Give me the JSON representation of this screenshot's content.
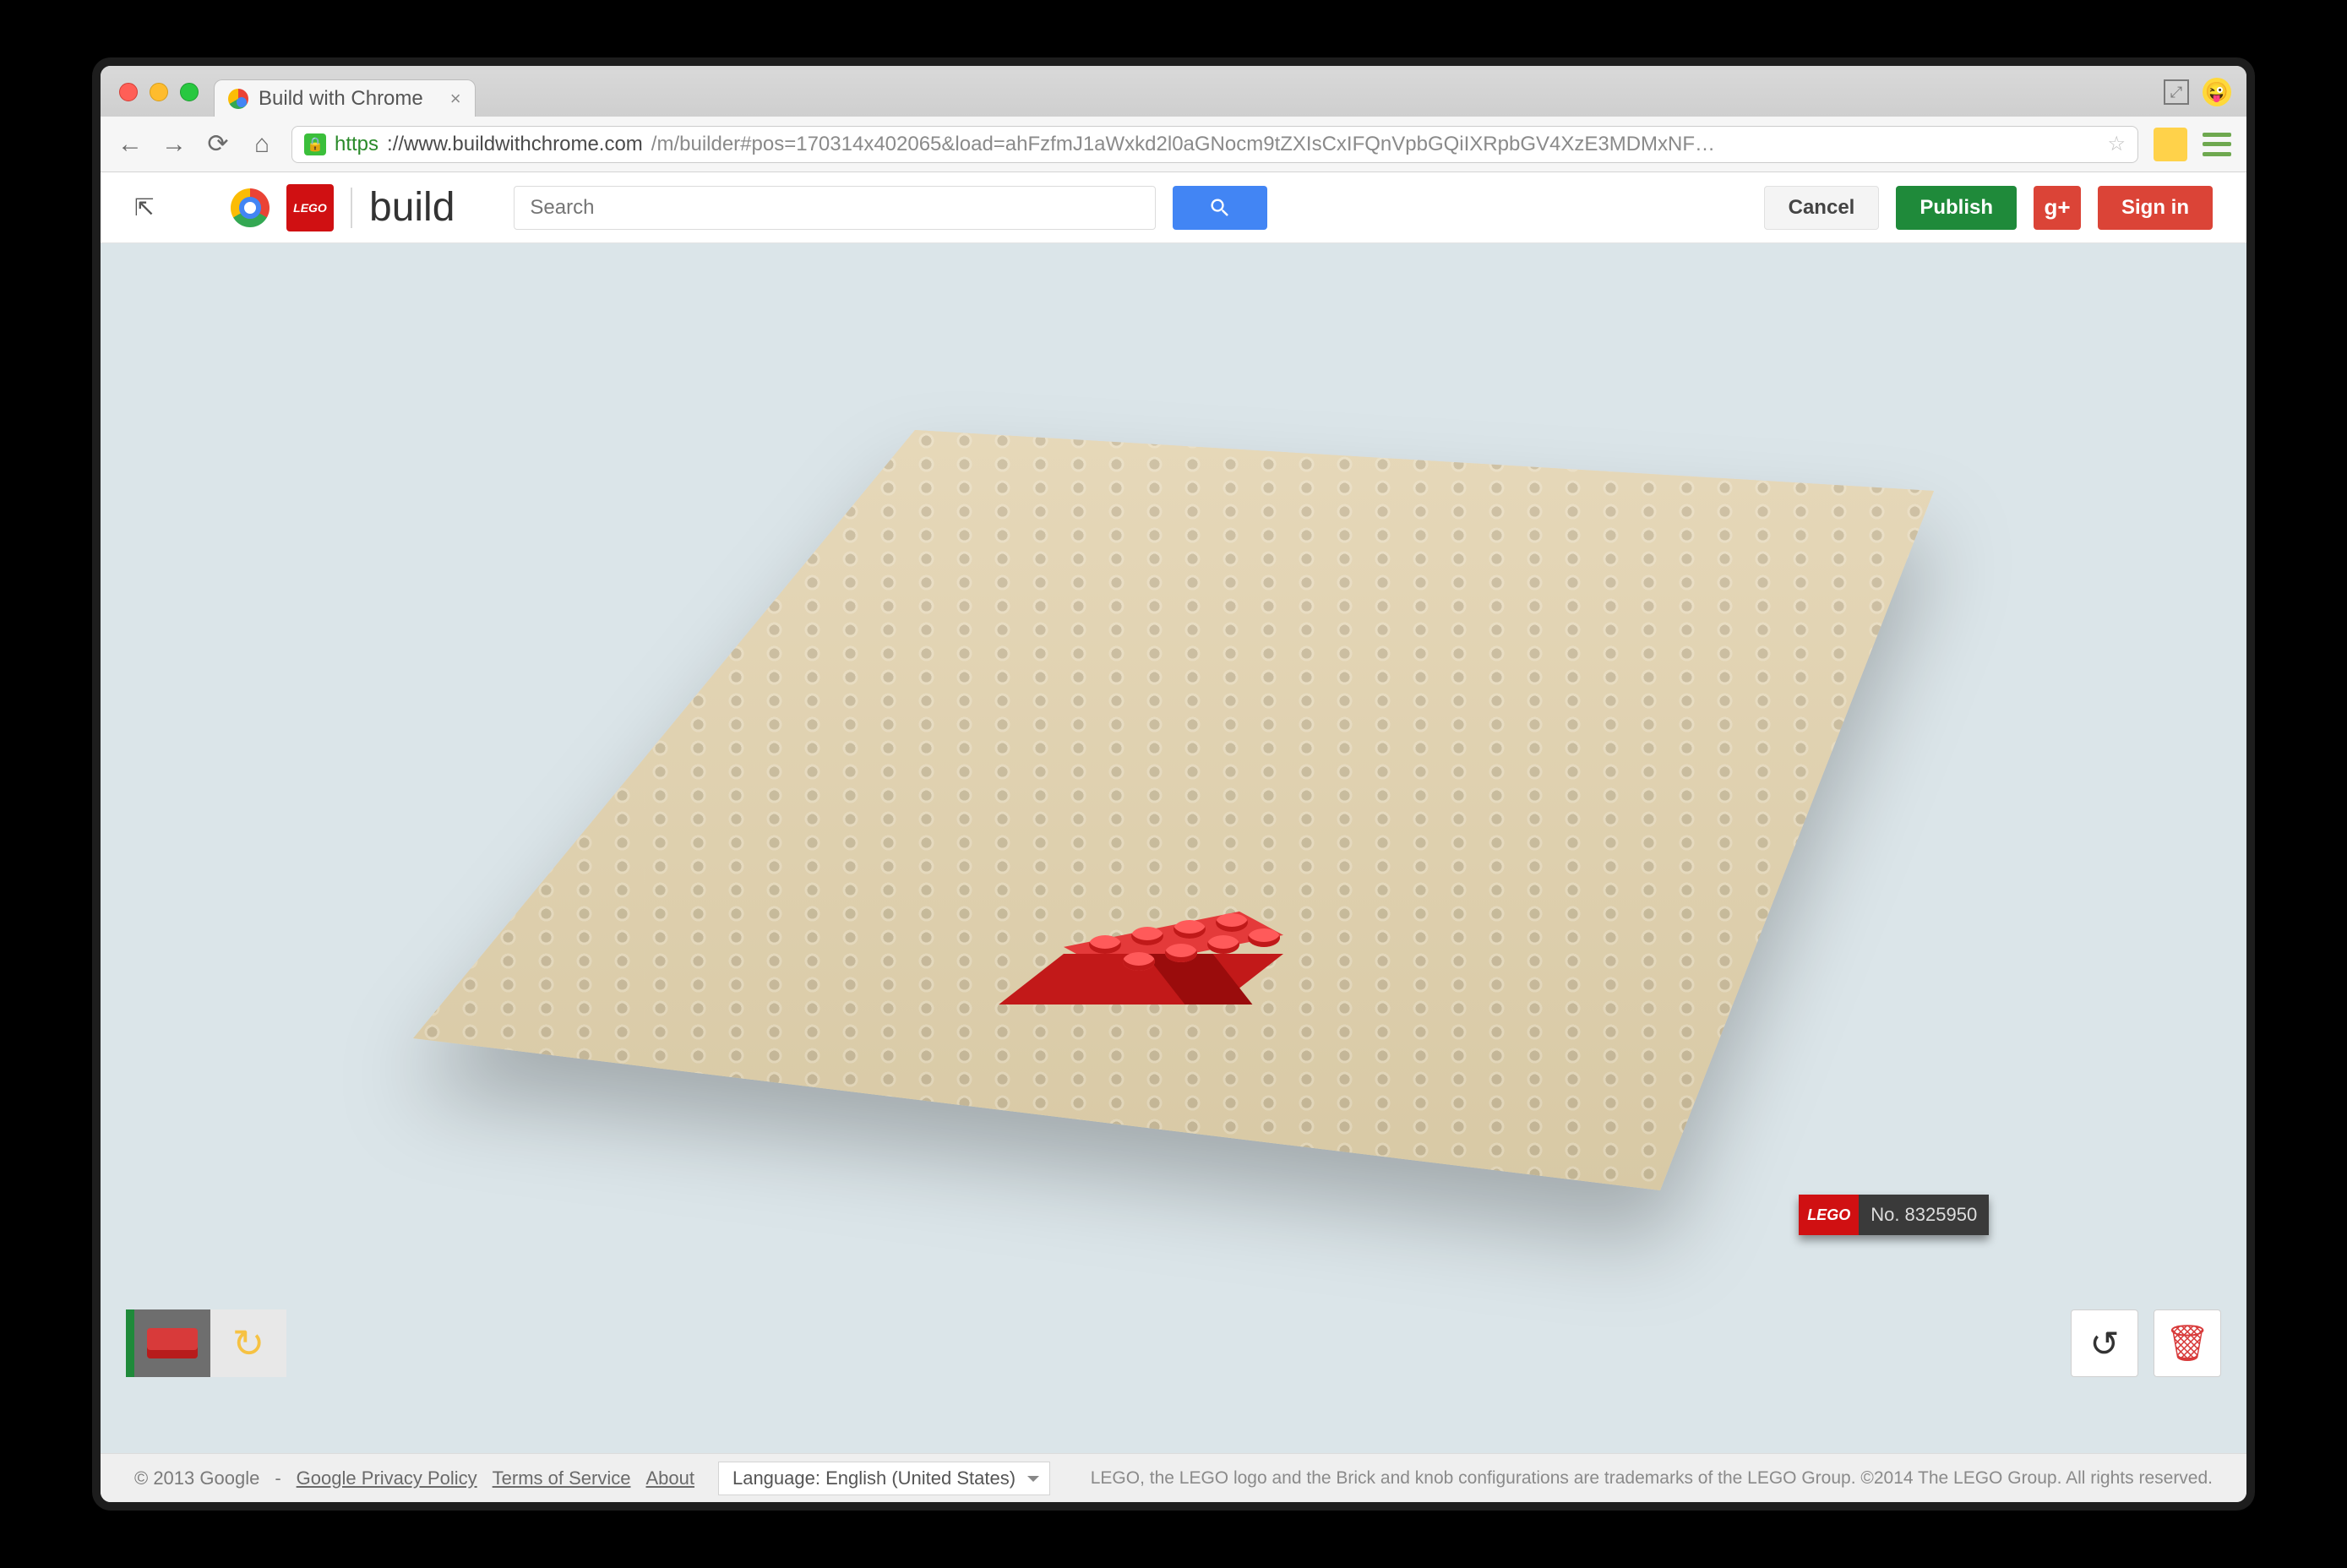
{
  "browser": {
    "tab_title": "Build with Chrome",
    "url_scheme": "https",
    "url_host": "://www.buildwithchrome.com",
    "url_path": "/m/builder#pos=170314x402065&load=ahFzfmJ1aWxkd2l0aGNocm9tZXIsCxIFQnVpbGQiIXRpbGV4XzE3MDMxNF…"
  },
  "header": {
    "brand": "build",
    "lego_text": "LEGO",
    "search_placeholder": "Search",
    "cancel": "Cancel",
    "publish": "Publish",
    "gplus": "g+",
    "signin": "Sign in"
  },
  "plate": {
    "lego_text": "LEGO",
    "build_no_label": "No. 8325950"
  },
  "footer": {
    "copyright": "© 2013 Google",
    "dash": "-",
    "privacy": "Google Privacy Policy",
    "terms": "Terms of Service",
    "about": "About",
    "language_label": "Language: English (United States)",
    "legal": "LEGO, the LEGO logo and the Brick and knob configurations are trademarks of the LEGO Group. ©2014 The LEGO Group. All rights reserved."
  }
}
